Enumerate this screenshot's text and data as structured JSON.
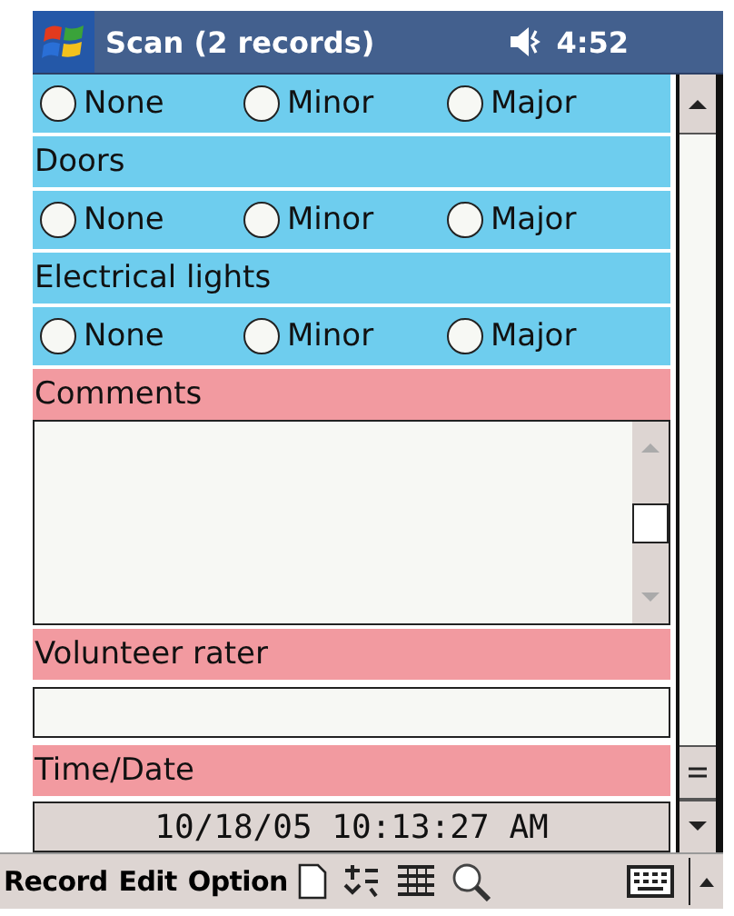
{
  "window": {
    "title": "Scan (2 records)",
    "time": "4:52"
  },
  "form": [
    {
      "kind": "radios",
      "color": "#6ecdee",
      "options": [
        {
          "label": "None",
          "selected": false
        },
        {
          "label": "Minor",
          "selected": false
        },
        {
          "label": "Major",
          "selected": false
        }
      ]
    },
    {
      "kind": "heading",
      "color": "#6ecdee",
      "text": "Doors"
    },
    {
      "kind": "radios",
      "color": "#6ecdee",
      "options": [
        {
          "label": "None",
          "selected": false
        },
        {
          "label": "Minor",
          "selected": false
        },
        {
          "label": "Major",
          "selected": false
        }
      ]
    },
    {
      "kind": "heading",
      "color": "#6ecdee",
      "text": "Electrical lights"
    },
    {
      "kind": "radios",
      "color": "#6ecdee",
      "options": [
        {
          "label": "None",
          "selected": false
        },
        {
          "label": "Minor",
          "selected": false
        },
        {
          "label": "Major",
          "selected": false
        }
      ]
    },
    {
      "kind": "heading",
      "color": "#f29aa0",
      "text": "Comments"
    },
    {
      "kind": "textarea"
    },
    {
      "kind": "heading",
      "color": "#f29aa0",
      "text": "Volunteer rater"
    },
    {
      "kind": "input"
    },
    {
      "kind": "heading",
      "color": "#f29aa0",
      "text": "Time/Date"
    },
    {
      "kind": "datetime",
      "value": "10/18/05 10:13:27 AM"
    }
  ],
  "menu": [
    "Record",
    "Edit",
    "Option"
  ]
}
